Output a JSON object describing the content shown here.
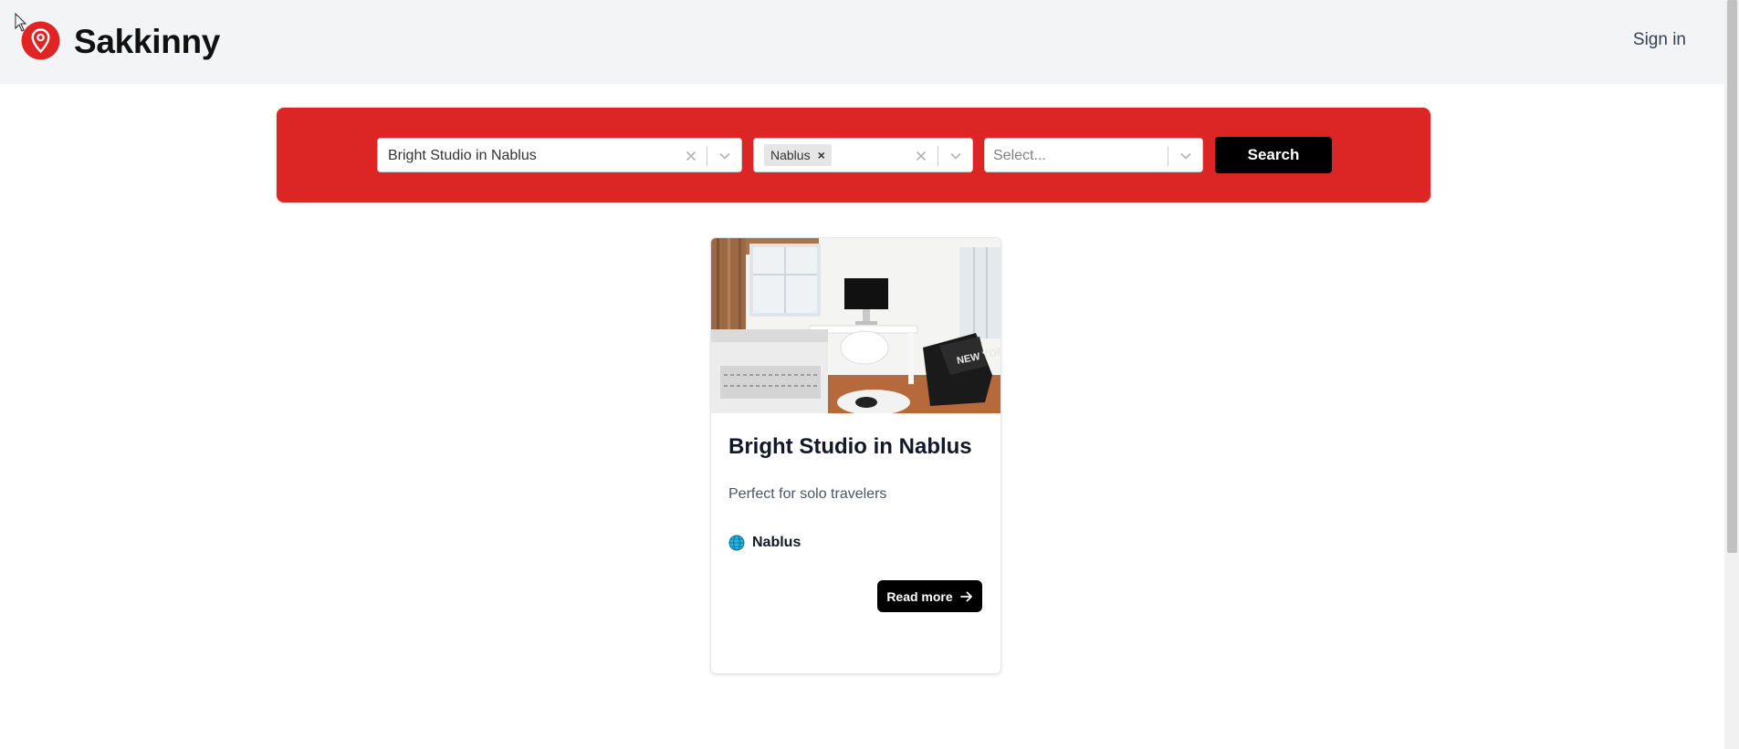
{
  "header": {
    "brand": "Sakkinny",
    "sign_in": "Sign in",
    "logo_icon": "map-pin-icon"
  },
  "search": {
    "title_select": {
      "value": "Bright Studio in Nablus"
    },
    "city_select": {
      "tags": [
        "Nablus"
      ]
    },
    "third_select": {
      "placeholder": "Select..."
    },
    "button_label": "Search"
  },
  "listings": [
    {
      "title": "Bright Studio in Nablus",
      "description": "Perfect for solo travelers",
      "location": "Nablus",
      "location_icon": "globe-icon",
      "read_more": "Read more"
    }
  ],
  "colors": {
    "accent": "#dc2626",
    "header_bg": "#f3f4f6",
    "button": "#000000"
  }
}
